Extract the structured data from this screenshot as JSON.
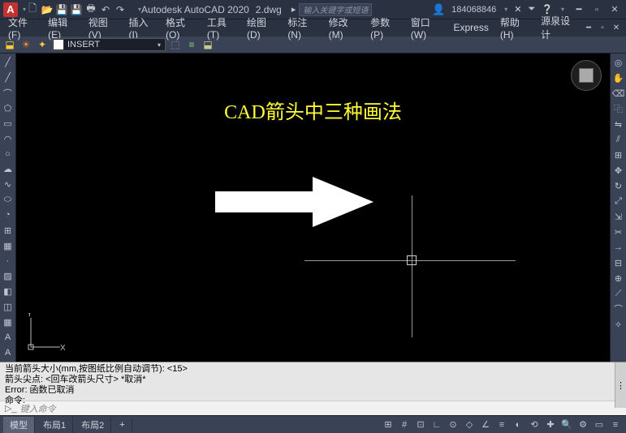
{
  "titlebar": {
    "app_title": "Autodesk AutoCAD 2020",
    "file_name": "2.dwg",
    "search_placeholder": "输入关键字或短语",
    "user_id": "184068846"
  },
  "menus": [
    "文件(F)",
    "编辑(E)",
    "视图(V)",
    "插入(I)",
    "格式(O)",
    "工具(T)",
    "绘图(D)",
    "标注(N)",
    "修改(M)",
    "参数(P)",
    "窗口(W)",
    "Express",
    "帮助(H)",
    "源泉设计"
  ],
  "toolbar2": {
    "insert_value": "INSERT"
  },
  "canvas": {
    "title_text": "CAD箭头中三种画法",
    "ucs_x": "X",
    "ucs_y": "Y"
  },
  "command": {
    "line1": "当前箭头大小(mm,按图纸比例自动调节): <15>",
    "line2": "箭头尖点: <回车改箭头尺寸> *取消*",
    "line3": "Error: 函数已取消",
    "line4": "命令:",
    "prompt": "键入命令"
  },
  "status": {
    "tabs": [
      "模型",
      "布局1",
      "布局2"
    ]
  }
}
